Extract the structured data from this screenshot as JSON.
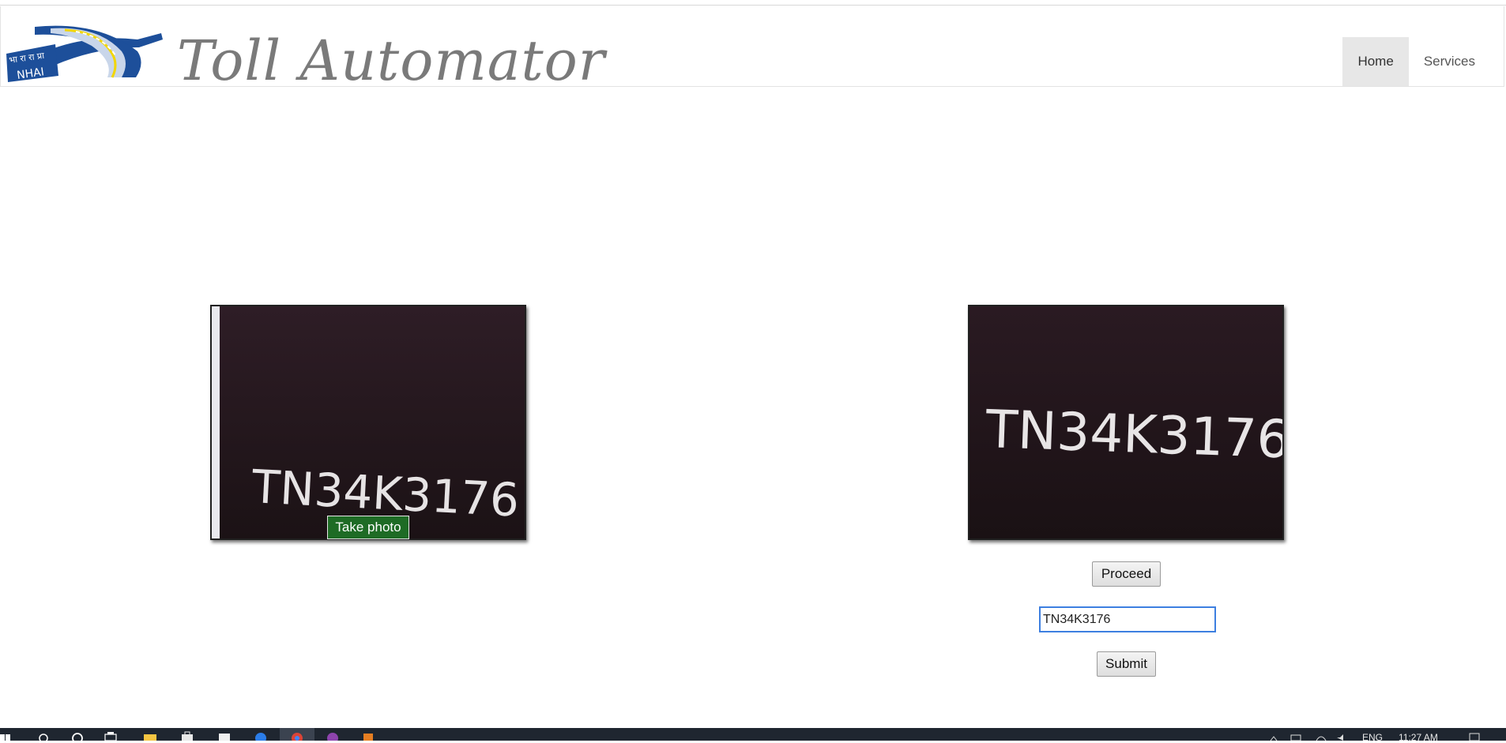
{
  "header": {
    "title": "Toll Automator",
    "logo": {
      "name": "nhai-logo",
      "text_top": "भा रा रा प्रा",
      "text_bottom": "NHAI"
    },
    "nav": [
      {
        "label": "Home",
        "active": true
      },
      {
        "label": "Services",
        "active": false
      }
    ]
  },
  "camera_feed": {
    "plate_text": "TN34K3176",
    "take_photo_label": "Take photo"
  },
  "captured_image": {
    "plate_text": "TN34K3176"
  },
  "actions": {
    "proceed_label": "Proceed",
    "plate_input_value": "TN34K3176",
    "submit_label": "Submit"
  },
  "taskbar": {
    "lang": "ENG",
    "clock": "11:27 AM",
    "icons": [
      "start-icon",
      "search-icon",
      "cortana-icon",
      "task-view-icon",
      "file-explorer-icon",
      "store-icon",
      "edge-icon",
      "chrome-icon",
      "app-icon",
      "app2-icon"
    ]
  },
  "colors": {
    "take_photo_bg": "#1e6b25",
    "input_focus": "#3d7fe0",
    "nav_active_bg": "#e7e7e7"
  }
}
